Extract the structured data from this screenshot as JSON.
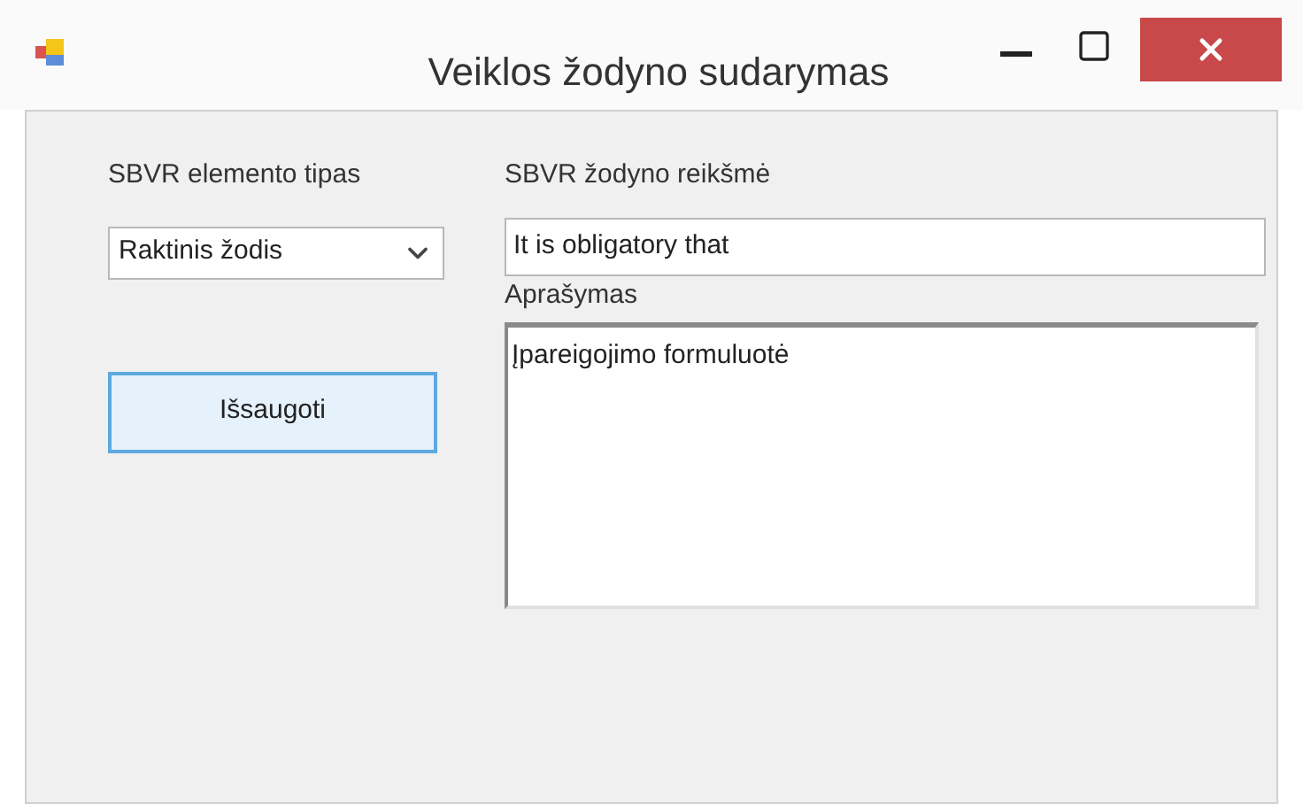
{
  "window": {
    "title": "Veiklos žodyno sudarymas"
  },
  "element_type": {
    "label": "SBVR elemento tipas",
    "value": "Raktinis žodis"
  },
  "save_button": {
    "label": "Išsaugoti",
    "focused": true
  },
  "vocabulary_value": {
    "label": "SBVR žodyno reikšmė",
    "value": "It is obligatory that"
  },
  "description": {
    "label": "Aprašymas",
    "value": "Įpareigojimo formuluotė"
  }
}
